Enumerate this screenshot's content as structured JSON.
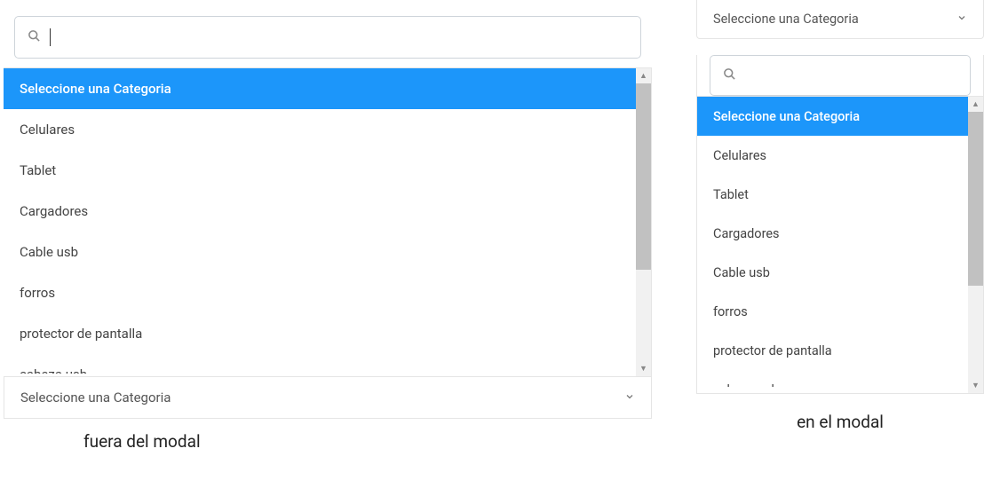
{
  "left": {
    "search_placeholder": "",
    "options": [
      "Seleccione una Categoria",
      "Celulares",
      "Tablet",
      "Cargadores",
      "Cable usb",
      "forros",
      "protector de pantalla",
      "cabeza usb"
    ],
    "collapsed_label": "Seleccione una Categoria",
    "caption": "fuera del modal"
  },
  "right": {
    "collapsed_label": "Seleccione una Categoria",
    "search_placeholder": "",
    "options": [
      "Seleccione una Categoria",
      "Celulares",
      "Tablet",
      "Cargadores",
      "Cable usb",
      "forros",
      "protector de pantalla",
      "cabeza usb"
    ],
    "caption": "en el modal"
  }
}
